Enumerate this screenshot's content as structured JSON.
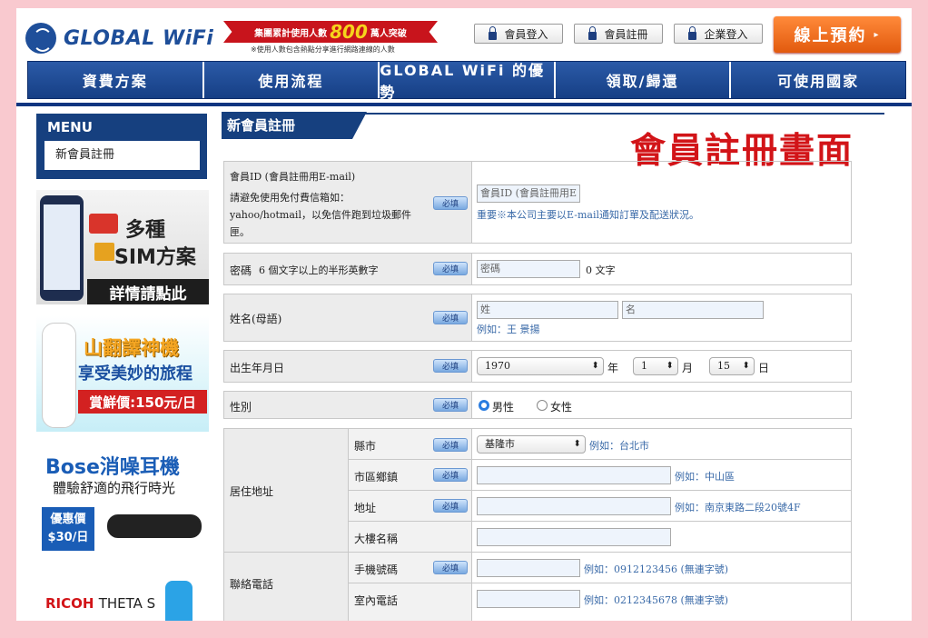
{
  "header": {
    "logo_text": "GLOBAL WiFi",
    "banner": {
      "pre": "集團累計使用人數",
      "number": "800",
      "post": "萬人突破",
      "note": "※使用人數包含熱點分享進行網路連線的人數"
    },
    "buttons": [
      "會員登入",
      "會員註冊",
      "企業登入"
    ],
    "reserve_label": "線上預約",
    "reserve_arrow": "▸"
  },
  "nav": [
    "資費方案",
    "使用流程",
    "GLOBAL WiFi 的優勢",
    "領取/歸還",
    "可使用國家"
  ],
  "sidebar": {
    "menu_title": "MENU",
    "menu_item": "新會員註冊",
    "ads": {
      "sim": {
        "line1": "多種",
        "line2": "SIM方案",
        "cta": "詳情請點此"
      },
      "translator": {
        "line1": "山翻譯神機",
        "line2": "享受美妙的旅程",
        "price": "賞鮮價:150元/日"
      },
      "bose": {
        "line1": "Bose消噪耳機",
        "line2": "體驗舒適的飛行時光",
        "price_label": "優惠價",
        "price": "$30/日"
      },
      "ricoh": {
        "brand": "RICOH",
        "model": "THETA S"
      }
    }
  },
  "main": {
    "title": "新會員註冊",
    "overlay": "會員註冊畫面",
    "required": "必填",
    "email": {
      "label": "會員ID (會員註冊用E-mail)",
      "note": "請避免使用免付費信箱如：yahoo/hotmail，以免信件跑到垃圾郵件匣。",
      "placeholder": "會員ID (會員註冊用E",
      "hint": "重要※本公司主要以E-mail通知訂單及配送狀況。"
    },
    "password": {
      "label": "密碼",
      "note": "6 個文字以上的半形英數字",
      "placeholder": "密碼",
      "count": "0 文字"
    },
    "name": {
      "label": "姓名(母語)",
      "last": "姓",
      "first": "名",
      "hint": "例如：王 景揚"
    },
    "birth": {
      "label": "出生年月日",
      "year": "1970",
      "year_unit": "年",
      "month": "1",
      "month_unit": "月",
      "day": "15",
      "day_unit": "日"
    },
    "gender": {
      "label": "性別",
      "male": "男性",
      "female": "女性"
    },
    "address": {
      "label": "居住地址",
      "county_label": "縣市",
      "county_value": "基隆市",
      "county_hint": "例如：台北市",
      "district_label": "市區鄉鎮",
      "district_hint": "例如：中山區",
      "street_label": "地址",
      "street_hint": "例如：南京東路二段20號4F",
      "building_label": "大樓名稱"
    },
    "phone": {
      "label": "聯絡電話",
      "mobile_label": "手機號碼",
      "mobile_hint": "例如：0912123456 (無連字號)",
      "home_label": "室內電話",
      "home_hint": "例如：0212345678 (無連字號)"
    }
  },
  "colors": {
    "brand": "#16407f",
    "accent": "#d21418",
    "reserve": "#e25a0e",
    "background": "#f9c9cf"
  }
}
